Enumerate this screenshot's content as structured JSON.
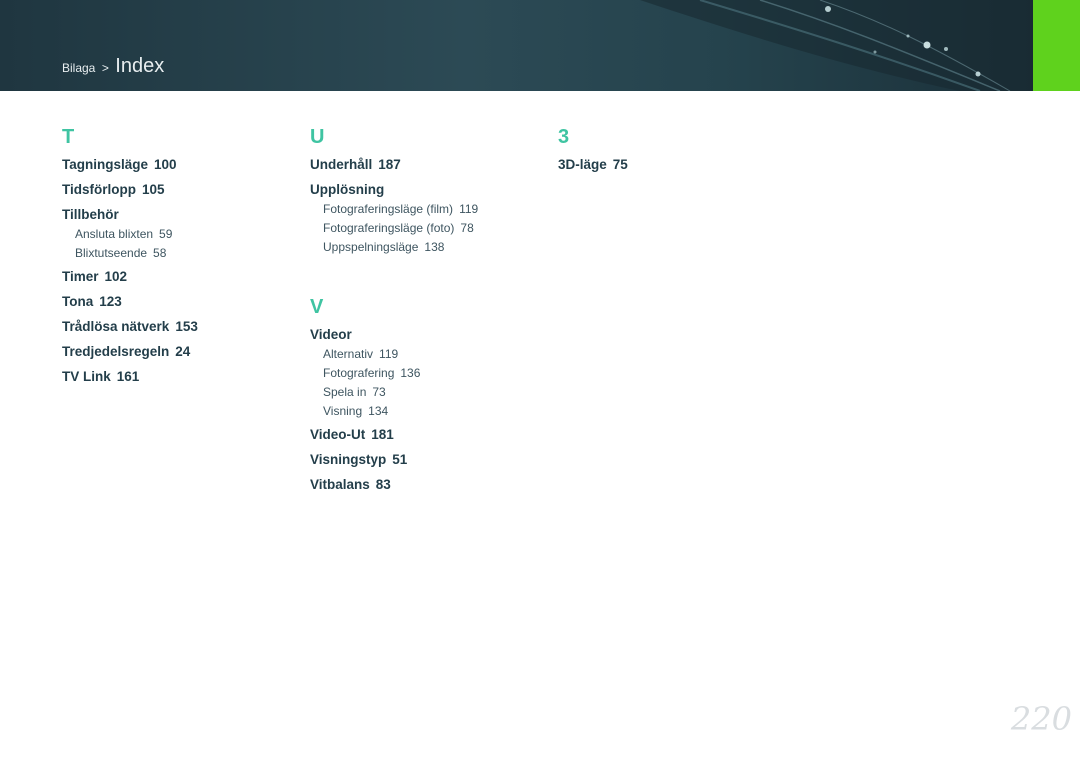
{
  "header": {
    "breadcrumb_parent": "Bilaga",
    "breadcrumb_separator": ">",
    "breadcrumb_current": "Index",
    "accent_color": "#5fd21d"
  },
  "columns": {
    "t": {
      "letter": "T",
      "entries": [
        {
          "term": "Tagningsläge",
          "page": "100"
        },
        {
          "term": "Tidsförlopp",
          "page": "105"
        },
        {
          "term": "Tillbehör",
          "page": "",
          "subs": [
            {
              "term": "Ansluta blixten",
              "page": "59"
            },
            {
              "term": "Blixtutseende",
              "page": "58"
            }
          ]
        },
        {
          "term": "Timer",
          "page": "102"
        },
        {
          "term": "Tona",
          "page": "123"
        },
        {
          "term": "Trådlösa nätverk",
          "page": "153"
        },
        {
          "term": "Tredjedelsregeln",
          "page": "24"
        },
        {
          "term": "TV Link",
          "page": "161"
        }
      ]
    },
    "u": {
      "letter": "U",
      "entries": [
        {
          "term": "Underhåll",
          "page": "187"
        },
        {
          "term": "Upplösning",
          "page": "",
          "subs": [
            {
              "term": "Fotograferingsläge (film)",
              "page": "119"
            },
            {
              "term": "Fotograferingsläge (foto)",
              "page": "78"
            },
            {
              "term": "Uppspelningsläge",
              "page": "138"
            }
          ]
        }
      ]
    },
    "v": {
      "letter": "V",
      "entries": [
        {
          "term": "Videor",
          "page": "",
          "subs": [
            {
              "term": "Alternativ",
              "page": "119"
            },
            {
              "term": "Fotografering",
              "page": "136"
            },
            {
              "term": "Spela in",
              "page": "73"
            },
            {
              "term": "Visning",
              "page": "134"
            }
          ]
        },
        {
          "term": "Video-Ut",
          "page": "181"
        },
        {
          "term": "Visningstyp",
          "page": "51"
        },
        {
          "term": "Vitbalans",
          "page": "83"
        }
      ]
    },
    "three": {
      "letter": "3",
      "entries": [
        {
          "term": "3D-läge",
          "page": "75"
        }
      ]
    }
  },
  "page_number": "220"
}
